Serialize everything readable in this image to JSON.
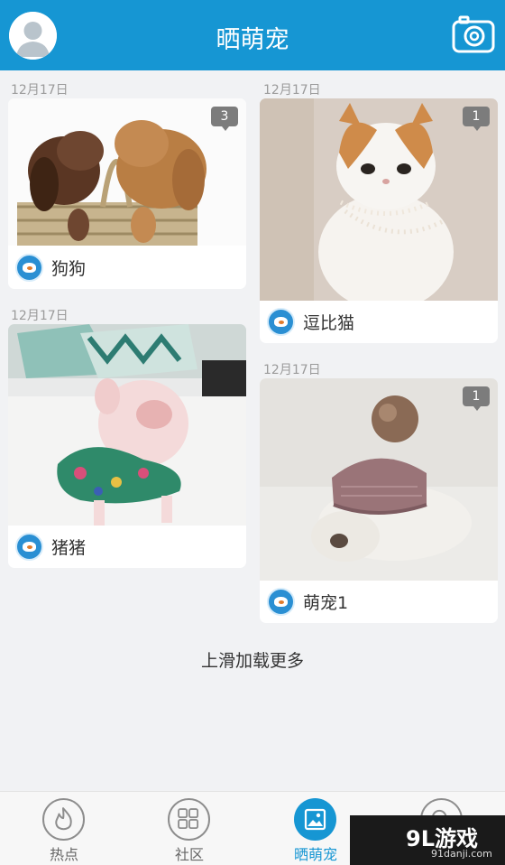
{
  "header": {
    "title": "晒萌宠",
    "avatar_icon": "user-avatar-icon",
    "camera_icon": "camera-icon"
  },
  "feed": {
    "left": [
      {
        "date": "12月17日",
        "name": "狗狗",
        "comments": "3",
        "photo": "puppies-photo"
      },
      {
        "date": "12月17日",
        "name": "猪猪",
        "comments": "",
        "photo": "pig-photo"
      }
    ],
    "right": [
      {
        "date": "12月17日",
        "name": "逗比猫",
        "comments": "1",
        "photo": "cat-photo"
      },
      {
        "date": "12月17日",
        "name": "萌宠1",
        "comments": "1",
        "photo": "rabbit-photo"
      }
    ]
  },
  "load_more": "上滑加载更多",
  "tabs": [
    {
      "label": "热点",
      "icon": "fire-icon",
      "active": false
    },
    {
      "label": "社区",
      "icon": "grid-icon",
      "active": false
    },
    {
      "label": "晒萌宠",
      "icon": "photo-icon",
      "active": true
    },
    {
      "label": "",
      "icon": "search-icon",
      "active": false
    }
  ],
  "watermark": {
    "brand": "游戏",
    "logo": "9L",
    "url": "91danji.com"
  },
  "colors": {
    "brand": "#1696d3",
    "background": "#f1f2f4",
    "badge": "#7c7c7c"
  }
}
